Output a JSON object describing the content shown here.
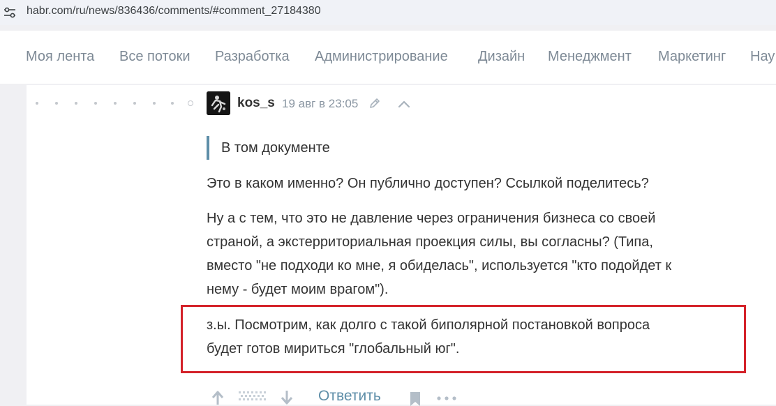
{
  "browser": {
    "url": "habr.com/ru/news/836436/comments/#comment_27184380",
    "site_settings_icon": "tune-icon"
  },
  "nav": {
    "items": [
      "Моя лента",
      "Все потоки",
      "Разработка",
      "Администрирование",
      "Дизайн",
      "Менеджмент",
      "Маркетинг",
      "Нау"
    ]
  },
  "comment": {
    "username": "kos_s",
    "timestamp": "19 авг в 23:05",
    "quote": "В том документе",
    "paragraphs": [
      [
        "Это в каком именно? Он публично доступен? Ссылкой поделитесь?"
      ],
      [
        "Ну а с тем, что это не давление через ограничения бизнеса со своей",
        "страной, а экстерриториальная проекция силы, вы согласны? (Типа,",
        "вместо \"не подходи ко мне, я обиделась\", используется \"кто подойдет к",
        "нему - будет моим врагом\")."
      ],
      [
        "з.ы. Посмотрим, как долго с такой биполярной постановкой вопроса",
        "будет готов мириться \"глобальный юг\"."
      ]
    ],
    "highlight_color": "#d4222a"
  },
  "actions": {
    "reply_label": "Ответить"
  },
  "colors": {
    "accent": "#5e8ea8",
    "text": "#333333",
    "muted": "#7e8a96"
  }
}
